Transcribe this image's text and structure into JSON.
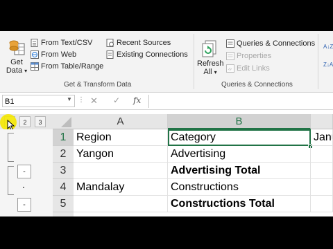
{
  "ribbon": {
    "get_data": {
      "line1": "Get",
      "line2": "Data",
      "arrow": "▾"
    },
    "from_text_csv": "From Text/CSV",
    "from_web": "From Web",
    "from_table_range": "From Table/Range",
    "recent_sources": "Recent Sources",
    "existing_connections": "Existing Connections",
    "group_get_transform": "Get & Transform Data",
    "refresh_all": {
      "line1": "Refresh",
      "line2": "All",
      "arrow": "▾"
    },
    "queries_connections": "Queries & Connections",
    "properties": "Properties",
    "edit_links": "Edit Links",
    "group_queries": "Queries & Connections",
    "sort_az": "A↓Z",
    "sort_za": "Z↓A"
  },
  "formula_bar": {
    "name_box": "B1",
    "cancel": "✕",
    "enter": "✓",
    "fx": "fx",
    "value": ""
  },
  "outline": {
    "levels": [
      "1",
      "2",
      "3"
    ],
    "collapse_label": "-"
  },
  "grid": {
    "columns": [
      "A",
      "B"
    ],
    "rows": [
      {
        "num": "1",
        "a": "Region",
        "b": "Category",
        "c": "Janu",
        "b_bold": false
      },
      {
        "num": "2",
        "a": "Yangon",
        "b": "Advertising",
        "c": "",
        "b_bold": false
      },
      {
        "num": "3",
        "a": "",
        "b": "Advertising Total",
        "c": "",
        "b_bold": true
      },
      {
        "num": "4",
        "a": "Mandalay",
        "b": "Constructions",
        "c": "",
        "b_bold": false
      },
      {
        "num": "5",
        "a": "",
        "b": "Constructions Total",
        "c": "",
        "b_bold": true
      }
    ]
  },
  "colors": {
    "accent": "#217346",
    "cursor": "#f5e800"
  }
}
